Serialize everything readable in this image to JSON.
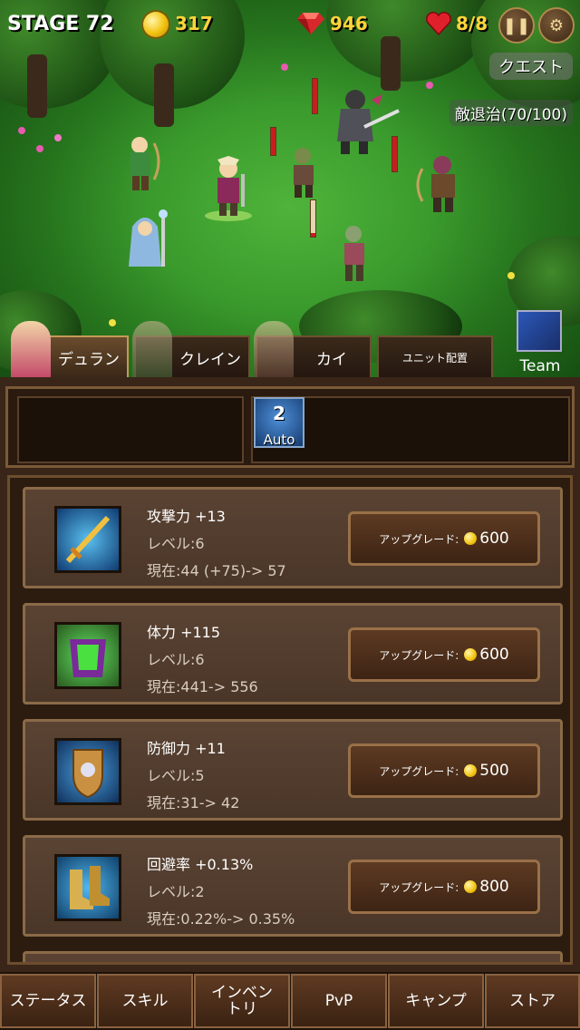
{
  "hud": {
    "stage": "STAGE 72",
    "gold": "317",
    "gems": "946",
    "lives": "8/8",
    "pause_icon": "pause-icon",
    "settings_icon": "gear-icon"
  },
  "quest": {
    "button_label": "クエスト",
    "progress": "敵退治(70/100)"
  },
  "tabs": [
    {
      "label": "デュラン",
      "active": true
    },
    {
      "label": "クレイン",
      "active": false
    },
    {
      "label": "カイ",
      "active": false
    },
    {
      "label": "ユニット配置",
      "active": false
    }
  ],
  "team_button": {
    "label": "Team"
  },
  "auto_skill": {
    "level": "2",
    "label": "Auto"
  },
  "upgrades": [
    {
      "title": "攻撃力 +13",
      "level": "レベル:6",
      "current": "現在:44 (+75)-> 57",
      "button_label": "アップグレード:",
      "cost": "600",
      "icon": "sword-icon"
    },
    {
      "title": "体力 +115",
      "level": "レベル:6",
      "current": "現在:441-> 556",
      "button_label": "アップグレード:",
      "cost": "600",
      "icon": "armor-icon"
    },
    {
      "title": "防御力 +11",
      "level": "レベル:5",
      "current": "現在:31-> 42",
      "button_label": "アップグレード:",
      "cost": "500",
      "icon": "shield-icon"
    },
    {
      "title": "回避率 +0.13%",
      "level": "レベル:2",
      "current": "現在:0.22%-> 0.35%",
      "button_label": "アップグレード:",
      "cost": "800",
      "icon": "boots-icon"
    }
  ],
  "nav": [
    {
      "label": "ステータス"
    },
    {
      "label": "スキル"
    },
    {
      "label": "インベントリ"
    },
    {
      "label": "PvP"
    },
    {
      "label": "キャンプ"
    },
    {
      "label": "ストア"
    }
  ],
  "colors": {
    "gold": "#ffd43a",
    "panel": "#3a2618",
    "button": "#5d3a22"
  }
}
